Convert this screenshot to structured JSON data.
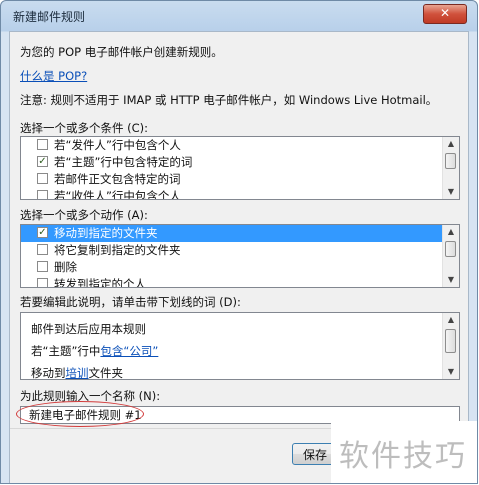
{
  "window": {
    "title": "新建邮件规则",
    "close_glyph": "✕"
  },
  "intro": {
    "line": "为您的 POP 电子邮件帐户创建新规则。",
    "link": "什么是 POP?",
    "notice": "注意: 规则不适用于 IMAP 或 HTTP 电子邮件帐户，如 Windows Live Hotmail。"
  },
  "conditions": {
    "label": "选择一个或多个条件 (C):",
    "items": [
      {
        "label": "若“发件人”行中包含个人",
        "checked": false
      },
      {
        "label": "若“主题”行中包含特定的词",
        "checked": true
      },
      {
        "label": "若邮件正文包含特定的词",
        "checked": false
      },
      {
        "label": "若“收件人”行中包含个人",
        "checked": false
      }
    ]
  },
  "actions": {
    "label": "选择一个或多个动作 (A):",
    "items": [
      {
        "label": "移动到指定的文件夹",
        "checked": true,
        "selected": true
      },
      {
        "label": "将它复制到指定的文件夹",
        "checked": false
      },
      {
        "label": "删除",
        "checked": false
      },
      {
        "label": "转发到指定的个人",
        "checked": false
      }
    ]
  },
  "description": {
    "label": "若要编辑此说明，请单击带下划线的词 (D):",
    "line1": "邮件到达后应用本规则",
    "line2_prefix": "若“主题”行中",
    "line2_link": "包含“公司”",
    "line3_prefix": "移动到",
    "line3_link": "培训",
    "line3_suffix": "文件夹"
  },
  "name": {
    "label": "为此规则输入一个名称 (N):",
    "value": "新建电子邮件规则 #1"
  },
  "buttons": {
    "save": "保存"
  },
  "watermark": "软件技巧",
  "colors": {
    "accent_blue": "#3399ff",
    "link_blue": "#0a4fb8",
    "highlight_red": "#d23a3a"
  }
}
